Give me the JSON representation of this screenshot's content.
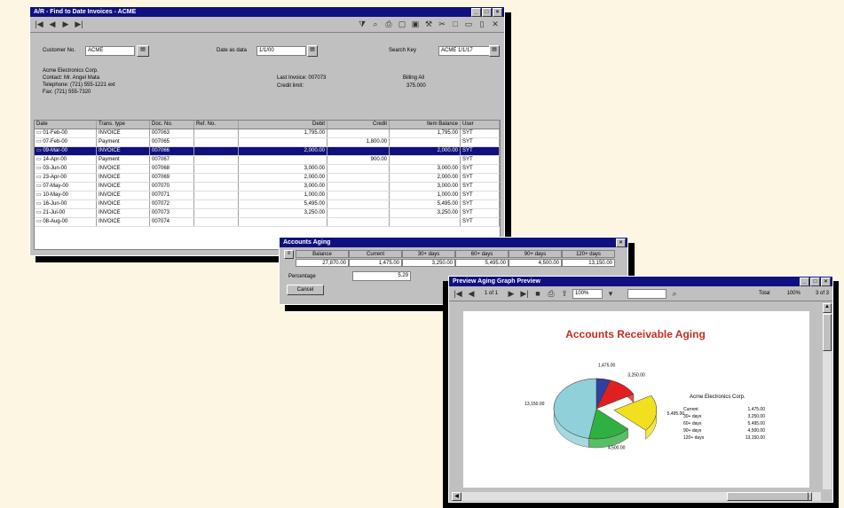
{
  "w1": {
    "title": "A/R - Find to Date Invoices - ACME",
    "customer_label": "Customer No.",
    "customer_value": "ACME",
    "date_label": "Date as data",
    "date_value": "1/1/00",
    "search_label": "Search Key",
    "search_value": "ACME 1/1/17",
    "company": "Acme Electronics Corp.",
    "contact": "Contact: Mr. Angel Mata",
    "telephone": "Telephone: (721) 555-1221 ext",
    "fax": "Fax: (721) 555-7320",
    "last_invoice": "Last Invoice: 007073",
    "credit_limit": "Credit limit:",
    "billing_label": "Billing All",
    "billing_value": "375.000",
    "columns": [
      "Date",
      "Trans. type",
      "Doc. No.",
      "Ref. No.",
      "Debit",
      "Credit",
      "Item Balance",
      "User"
    ],
    "rows": [
      [
        "01-Feb-00",
        "INVOICE",
        "007063",
        "",
        "1,795.00",
        "",
        "1,795.00",
        "SYT"
      ],
      [
        "07-Feb-00",
        "Payment",
        "007065",
        "",
        "",
        "1,800.00",
        "",
        "SYT"
      ],
      [
        "09-Mar-00",
        "INVOICE",
        "007066",
        "",
        "2,000.00",
        "",
        "2,000.00",
        "SYT"
      ],
      [
        "14-Apr-00",
        "Payment",
        "007067",
        "",
        "",
        "900.00",
        "",
        "SYT"
      ],
      [
        "03-Jun-00",
        "INVOICE",
        "007068",
        "",
        "3,000.00",
        "",
        "3,000.00",
        "SYT"
      ],
      [
        "23-Apr-00",
        "INVOICE",
        "007069",
        "",
        "2,000.00",
        "",
        "2,000.00",
        "SYT"
      ],
      [
        "07-May-00",
        "INVOICE",
        "007070",
        "",
        "3,000.00",
        "",
        "3,000.00",
        "SYT"
      ],
      [
        "10-May-00",
        "INVOICE",
        "007071",
        "",
        "1,000.00",
        "",
        "1,000.00",
        "SYT"
      ],
      [
        "16-Jun-00",
        "INVOICE",
        "007072",
        "",
        "5,495.00",
        "",
        "5,495.00",
        "SYT"
      ],
      [
        "21-Jul-00",
        "INVOICE",
        "007073",
        "",
        "3,250.00",
        "",
        "3,250.00",
        "SYT"
      ],
      [
        "08-Aug-00",
        "INVOICE",
        "007074",
        "",
        "",
        "",
        "",
        "SYT"
      ]
    ],
    "selected_row": 2
  },
  "w2": {
    "title": "Accounts Aging",
    "columns": [
      "Balance",
      "Current",
      "30+ days",
      "60+ days",
      "90+ days",
      "120+ days"
    ],
    "values": [
      "27,870.00",
      "1,475.00",
      "3,250.00",
      "5,495.00",
      "4,500.00",
      "13,150.00"
    ],
    "percentage_label": "Percentage",
    "percentage_value": "5.29",
    "cancel_label": "Cancel"
  },
  "w3": {
    "title": "Preview Aging Graph Preview",
    "page_field": "1 of 1",
    "zoom": "100%",
    "total": "Total",
    "count": "100%",
    "counter": "3 of 3",
    "chart_title": "Accounts Receivable Aging",
    "legend_company": "Acme Electronics Corp.",
    "legend_items": [
      {
        "label": "Current",
        "value": "1,475.00"
      },
      {
        "label": "30+ days",
        "value": "3,250.00"
      },
      {
        "label": "60+ days",
        "value": "5,495.00"
      },
      {
        "label": "90+ days",
        "value": "4,500.00"
      },
      {
        "label": "120+ days",
        "value": "13,150.00"
      }
    ],
    "slice_labels": [
      "1,475.00",
      "3,250.00",
      "5,495.00",
      "4,500.00",
      "13,150.00"
    ]
  },
  "chart_data": {
    "type": "pie",
    "title": "Accounts Receivable Aging",
    "categories": [
      "Current",
      "30+ days",
      "60+ days",
      "90+ days",
      "120+ days"
    ],
    "values": [
      1475,
      3250,
      5495,
      4500,
      13150
    ],
    "colors": [
      "#3040a0",
      "#e02020",
      "#f0e020",
      "#30b040",
      "#90d0d8"
    ]
  }
}
